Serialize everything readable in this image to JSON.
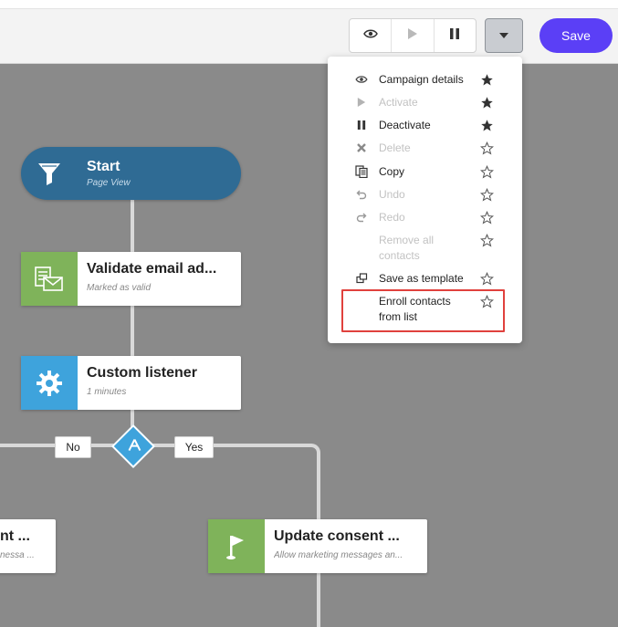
{
  "toolbar": {
    "save_label": "Save",
    "icons": [
      "eye-icon",
      "play-icon",
      "pause-icon",
      "caret-down-icon"
    ]
  },
  "canvas": {
    "nodes": {
      "start": {
        "title": "Start",
        "subtitle": "Page View",
        "icon": "funnel-icon",
        "color": "#2f6b94"
      },
      "validate": {
        "title": "Validate email ad...",
        "subtitle": "Marked as valid",
        "icon": "email-validate-icon",
        "color": "#7fb35a"
      },
      "listener": {
        "title": "Custom listener",
        "subtitle": "1 minutes",
        "icon": "gear-icon",
        "color": "#3ea3dc"
      },
      "left_partial": {
        "title": "nt ...",
        "subtitle": "nessa ..."
      },
      "consent": {
        "title": "Update consent ...",
        "subtitle": "Allow marketing messages an...",
        "icon": "flag-icon",
        "color": "#7fb35a"
      }
    },
    "branch_labels": {
      "no": "No",
      "yes": "Yes"
    }
  },
  "menu": {
    "items": [
      {
        "label": "Campaign details",
        "icon": "eye-icon",
        "disabled": false,
        "star": "filled"
      },
      {
        "label": "Activate",
        "icon": "play-icon",
        "disabled": true,
        "star": "filled"
      },
      {
        "label": "Deactivate",
        "icon": "pause-icon",
        "disabled": false,
        "star": "filled"
      },
      {
        "label": "Delete",
        "icon": "close-icon",
        "disabled": true,
        "star": "outline"
      },
      {
        "label": "Copy",
        "icon": "copy-icon",
        "disabled": false,
        "star": "outline"
      },
      {
        "label": "Undo",
        "icon": "undo-icon",
        "disabled": true,
        "star": "outline"
      },
      {
        "label": "Redo",
        "icon": "redo-icon",
        "disabled": true,
        "star": "outline"
      },
      {
        "label": "Remove all contacts",
        "icon": "",
        "disabled": true,
        "star": "outline"
      },
      {
        "label": "Save as template",
        "icon": "template-icon",
        "disabled": false,
        "star": "outline"
      },
      {
        "label": "Enroll contacts from list",
        "icon": "",
        "disabled": false,
        "star": "outline"
      }
    ]
  },
  "colors": {
    "accent": "#5b3ff6",
    "canvas": "#8a8a8a",
    "highlight": "#e0413d"
  }
}
